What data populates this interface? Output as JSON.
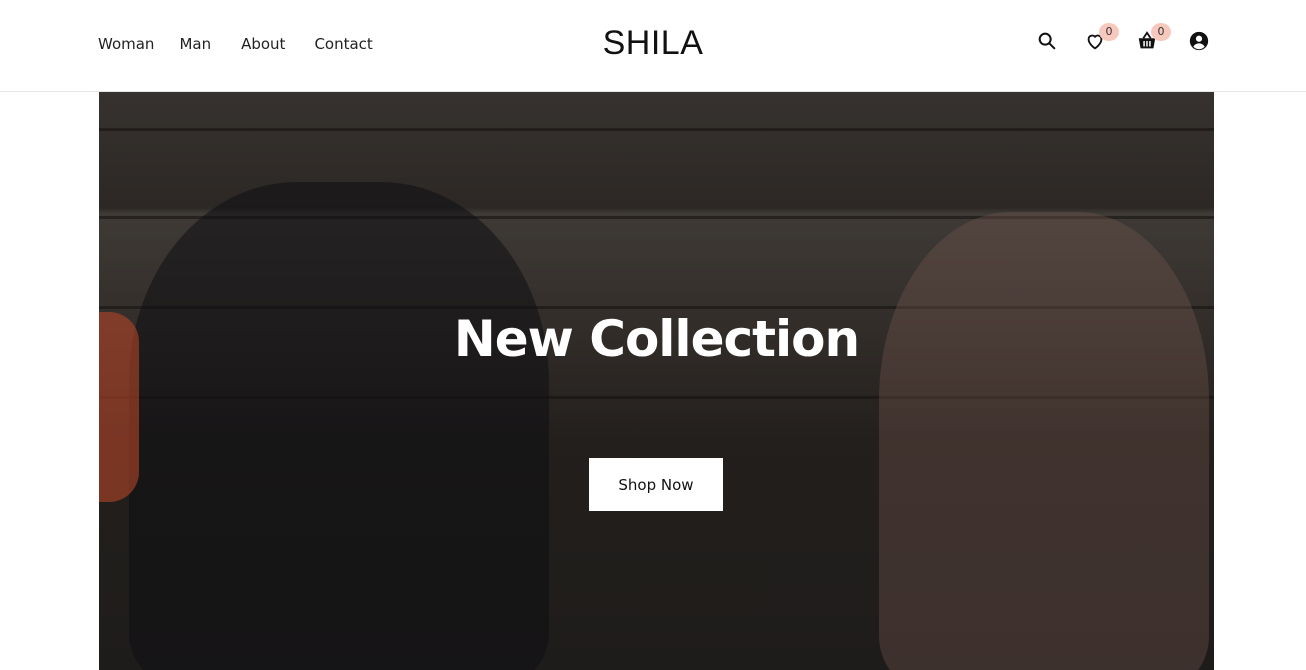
{
  "header": {
    "nav": [
      "Woman",
      "Man",
      "About",
      "Contact"
    ],
    "logo": "SHILA",
    "wishlist_count": "0",
    "cart_count": "0",
    "icons": [
      "search-icon",
      "heart-icon",
      "basket-icon",
      "user-icon"
    ]
  },
  "hero": {
    "title": "New Collection",
    "button_label": "Shop Now"
  },
  "colors": {
    "badge": "#f7c9bd",
    "text": "#111111",
    "button_bg": "#ffffff"
  }
}
